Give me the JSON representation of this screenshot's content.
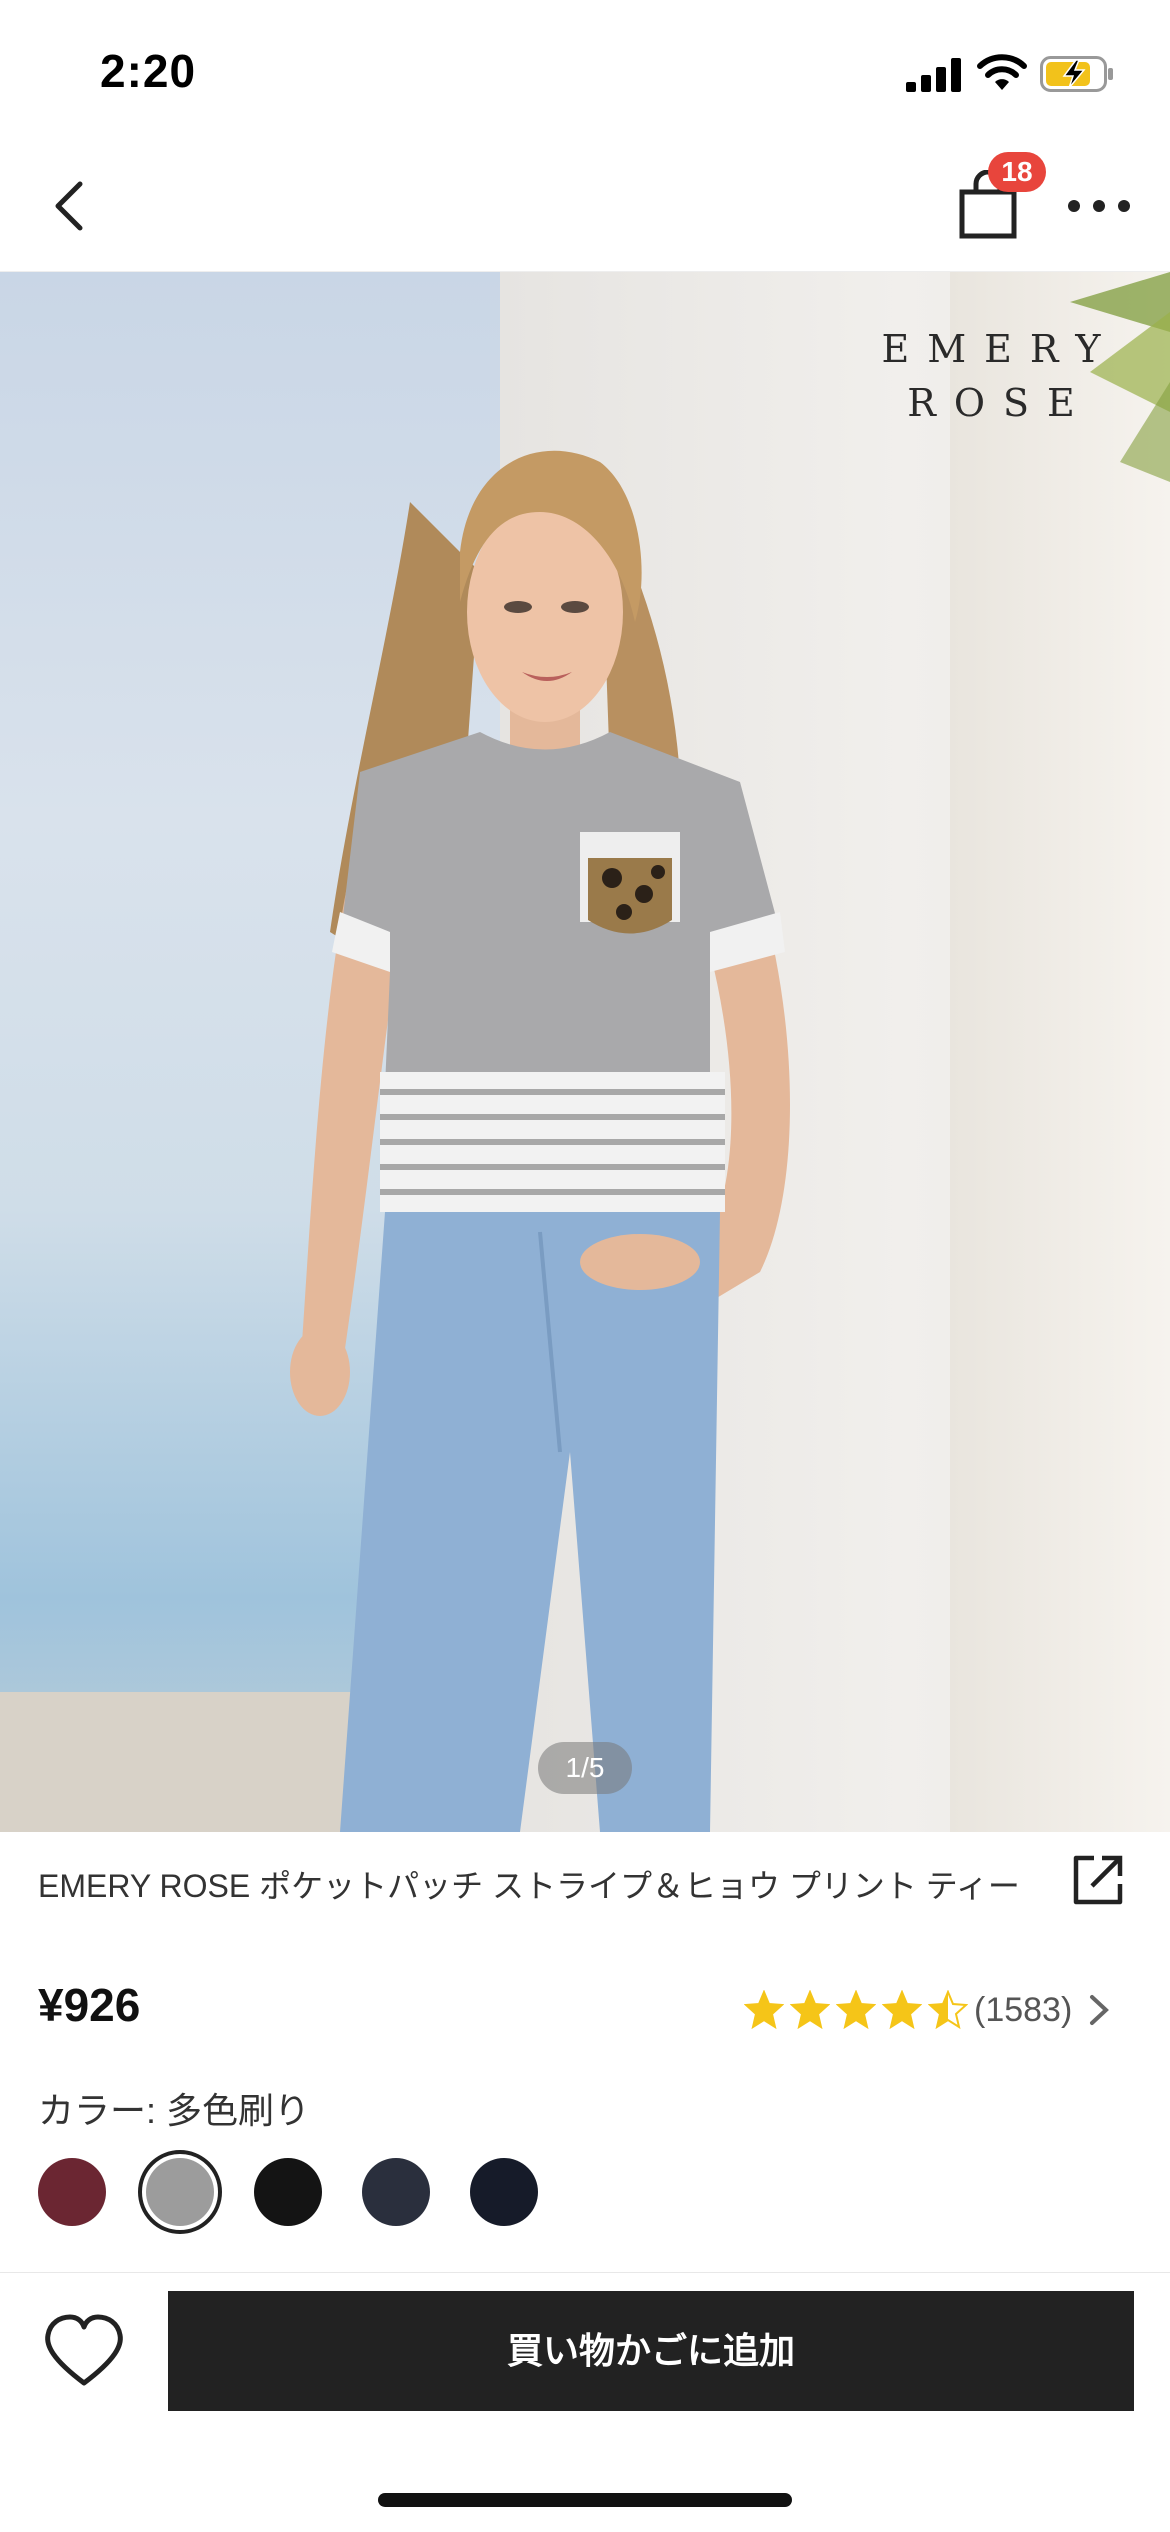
{
  "status_bar": {
    "time": "2:20"
  },
  "nav": {
    "cart_count": "18"
  },
  "brand": {
    "line1": "EMERY",
    "line2": "ROSE"
  },
  "gallery": {
    "indicator": "1/5",
    "current": 1,
    "total": 5
  },
  "product": {
    "title": "EMERY ROSE ポケットパッチ ストライプ＆ヒョウ プリント ティー",
    "price": "¥926",
    "rating": 4.5,
    "review_count": "(1583)"
  },
  "color": {
    "label": "カラー: 多色刷り",
    "swatches": [
      {
        "name": "burgundy",
        "hex": "#6b2632"
      },
      {
        "name": "grey",
        "hex": "#9c9c9c",
        "selected": true
      },
      {
        "name": "black",
        "hex": "#141414"
      },
      {
        "name": "charcoal-navy",
        "hex": "#2a2f3d"
      },
      {
        "name": "navy",
        "hex": "#161b29"
      }
    ]
  },
  "actions": {
    "add_to_cart": "買い物かごに追加"
  },
  "icons": {
    "back": "chevron-left-icon",
    "bag": "shopping-bag-icon",
    "more": "more-icon",
    "share": "share-icon",
    "wishlist": "heart-icon",
    "star": "star-icon",
    "chevron": "chevron-right-icon"
  },
  "colors": {
    "star": "#f5c518",
    "badge": "#e8453c",
    "button": "#222222"
  }
}
